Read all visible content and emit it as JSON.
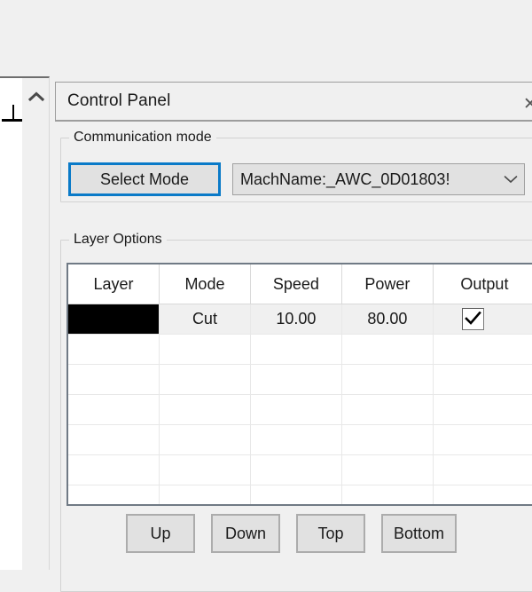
{
  "panel": {
    "title": "Control Panel",
    "close_icon": "close-icon",
    "close_glyph": "✕"
  },
  "toolstrip": {
    "collapse_icon": "chevron-up-icon"
  },
  "canvas": {
    "tool_icon": "perpendicular-tool-icon"
  },
  "communication": {
    "legend": "Communication mode",
    "select_mode_label": "Select Mode",
    "machine_value": "MachName:_AWC_0D01803!",
    "dropdown_icon": "chevron-down-icon",
    "focus_color": "#0a7ac8"
  },
  "layer_options": {
    "legend": "Layer Options",
    "columns": [
      "Layer",
      "Mode",
      "Speed",
      "Power",
      "Output"
    ],
    "rows": [
      {
        "layer_color": "#000000",
        "mode": "Cut",
        "speed": "10.00",
        "power": "80.00",
        "output": true,
        "selected": true
      },
      {
        "layer_color": "",
        "mode": "",
        "speed": "",
        "power": "",
        "output": null,
        "selected": false
      },
      {
        "layer_color": "",
        "mode": "",
        "speed": "",
        "power": "",
        "output": null,
        "selected": false
      },
      {
        "layer_color": "",
        "mode": "",
        "speed": "",
        "power": "",
        "output": null,
        "selected": false
      },
      {
        "layer_color": "",
        "mode": "",
        "speed": "",
        "power": "",
        "output": null,
        "selected": false
      },
      {
        "layer_color": "",
        "mode": "",
        "speed": "",
        "power": "",
        "output": null,
        "selected": false
      },
      {
        "layer_color": "",
        "mode": "",
        "speed": "",
        "power": "",
        "output": null,
        "selected": false
      }
    ]
  },
  "order_buttons": [
    {
      "label": "Up",
      "name": "move-up-button"
    },
    {
      "label": "Down",
      "name": "move-down-button"
    },
    {
      "label": "Top",
      "name": "move-top-button"
    },
    {
      "label": "Bottom",
      "name": "move-bottom-button"
    }
  ]
}
